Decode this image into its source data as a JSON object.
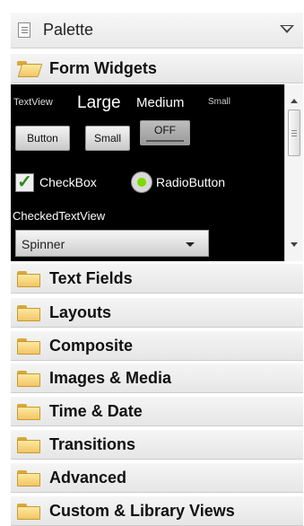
{
  "palette": {
    "title": "Palette",
    "icon": "list-icon",
    "menu_icon": "chevron-down-icon"
  },
  "open_category": {
    "label": "Form Widgets",
    "icon": "open-folder-icon"
  },
  "widgets": {
    "textview_small": "TextView",
    "large": "Large",
    "medium": "Medium",
    "small": "Small",
    "button": "Button",
    "small_button": "Small",
    "toggle": "OFF",
    "checkbox": "CheckBox",
    "radio": "RadioButton",
    "checked_textview": "CheckedTextView",
    "spinner": "Spinner"
  },
  "categories": [
    {
      "label": "Text Fields"
    },
    {
      "label": "Layouts"
    },
    {
      "label": "Composite"
    },
    {
      "label": "Images & Media"
    },
    {
      "label": "Time & Date"
    },
    {
      "label": "Transitions"
    },
    {
      "label": "Advanced"
    },
    {
      "label": "Custom & Library Views"
    }
  ],
  "colors": {
    "folder": "#f2c665",
    "preview_bg": "#000000",
    "radio_dot": "#7dd900",
    "check": "#2d8a1a"
  }
}
